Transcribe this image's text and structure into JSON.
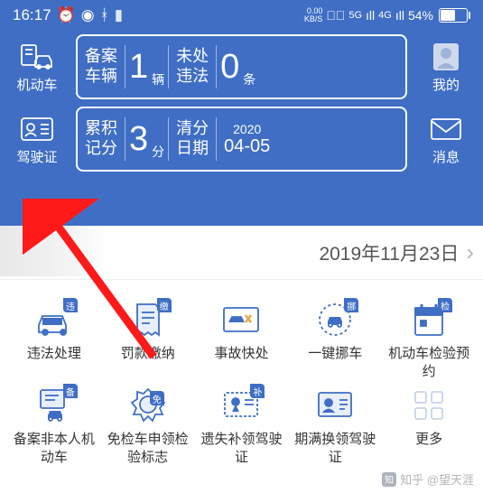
{
  "status": {
    "time": "16:17",
    "kbs_top": "0.00",
    "kbs_bot": "KB/S",
    "net1": "5G",
    "sig": "ıll",
    "net2": "4G",
    "sig2": "ıll",
    "battery_pct": "54%"
  },
  "side": {
    "vehicle": "机动车",
    "license": "驾驶证",
    "mine": "我的",
    "message": "消息"
  },
  "card1": {
    "label_a": "备案",
    "label_b": "车辆",
    "num": "1",
    "unit": "辆",
    "label_c": "未处",
    "label_d": "违法",
    "num2": "0",
    "unit2": "条"
  },
  "card2": {
    "label_a": "累积",
    "label_b": "记分",
    "num": "3",
    "unit": "分",
    "label_c": "清分",
    "label_d": "日期",
    "year": "2020",
    "date": "04-05"
  },
  "banner_date": "2019年11月23日",
  "grid": [
    {
      "label": "违法处理",
      "badge": "违"
    },
    {
      "label": "罚款缴纳",
      "badge": "缴"
    },
    {
      "label": "事故快处",
      "badge": ""
    },
    {
      "label": "一键挪车",
      "badge": "挪"
    },
    {
      "label": "机动车检验预约",
      "badge": "检"
    },
    {
      "label": "备案非本人机动车",
      "badge": "备"
    },
    {
      "label": "免检车申领检验标志",
      "badge": "免"
    },
    {
      "label": "遗失补领驾驶证",
      "badge": "补"
    },
    {
      "label": "期满换领驾驶证",
      "badge": ""
    },
    {
      "label": "更多",
      "badge": ""
    }
  ],
  "watermark": "知乎 @望天涯"
}
